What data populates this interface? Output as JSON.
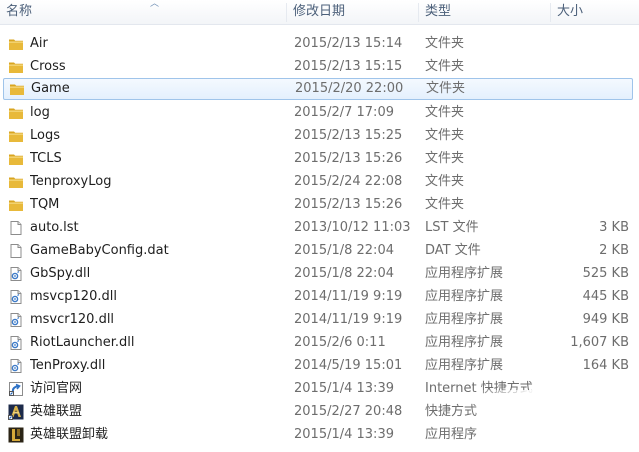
{
  "columns": {
    "name": "名称",
    "modified": "修改日期",
    "type": "类型",
    "size": "大小"
  },
  "files": [
    {
      "name": "Air",
      "modified": "2015/2/13 15:14",
      "type": "文件夹",
      "size": "",
      "icon": "folder-icon"
    },
    {
      "name": "Cross",
      "modified": "2015/2/13 15:15",
      "type": "文件夹",
      "size": "",
      "icon": "folder-icon"
    },
    {
      "name": "Game",
      "modified": "2015/2/20 22:00",
      "type": "文件夹",
      "size": "",
      "icon": "folder-icon",
      "selected": true
    },
    {
      "name": "log",
      "modified": "2015/2/7 17:09",
      "type": "文件夹",
      "size": "",
      "icon": "folder-icon"
    },
    {
      "name": "Logs",
      "modified": "2015/2/13 15:25",
      "type": "文件夹",
      "size": "",
      "icon": "folder-icon"
    },
    {
      "name": "TCLS",
      "modified": "2015/2/13 15:26",
      "type": "文件夹",
      "size": "",
      "icon": "folder-icon"
    },
    {
      "name": "TenproxyLog",
      "modified": "2015/2/24 22:08",
      "type": "文件夹",
      "size": "",
      "icon": "folder-icon"
    },
    {
      "name": "TQM",
      "modified": "2015/2/13 15:26",
      "type": "文件夹",
      "size": "",
      "icon": "folder-icon"
    },
    {
      "name": "auto.lst",
      "modified": "2013/10/12 11:03",
      "type": "LST 文件",
      "size": "3 KB",
      "icon": "file-icon"
    },
    {
      "name": "GameBabyConfig.dat",
      "modified": "2015/1/8 22:04",
      "type": "DAT 文件",
      "size": "2 KB",
      "icon": "file-icon"
    },
    {
      "name": "GbSpy.dll",
      "modified": "2015/1/8 22:04",
      "type": "应用程序扩展",
      "size": "525 KB",
      "icon": "dll-icon"
    },
    {
      "name": "msvcp120.dll",
      "modified": "2014/11/19 9:19",
      "type": "应用程序扩展",
      "size": "445 KB",
      "icon": "dll-icon"
    },
    {
      "name": "msvcr120.dll",
      "modified": "2014/11/19 9:19",
      "type": "应用程序扩展",
      "size": "949 KB",
      "icon": "dll-icon"
    },
    {
      "name": "RiotLauncher.dll",
      "modified": "2015/2/6 0:11",
      "type": "应用程序扩展",
      "size": "1,607 KB",
      "icon": "dll-icon"
    },
    {
      "name": "TenProxy.dll",
      "modified": "2014/5/19 15:01",
      "type": "应用程序扩展",
      "size": "164 KB",
      "icon": "dll-icon"
    },
    {
      "name": "访问官网",
      "modified": "2015/1/4 13:39",
      "type": "Internet 快捷方式",
      "size": "",
      "icon": "internet-shortcut-icon"
    },
    {
      "name": "英雄联盟",
      "modified": "2015/2/27 20:48",
      "type": "快捷方式",
      "size": "",
      "icon": "game-shortcut-icon"
    },
    {
      "name": "英雄联盟卸载",
      "modified": "2015/1/4 13:39",
      "type": "应用程序",
      "size": "",
      "icon": "uninstall-app-icon"
    }
  ],
  "colors": {
    "folder": "#e8b93a",
    "selection_border": "#9fc4ea",
    "header_text": "#4c607a"
  }
}
